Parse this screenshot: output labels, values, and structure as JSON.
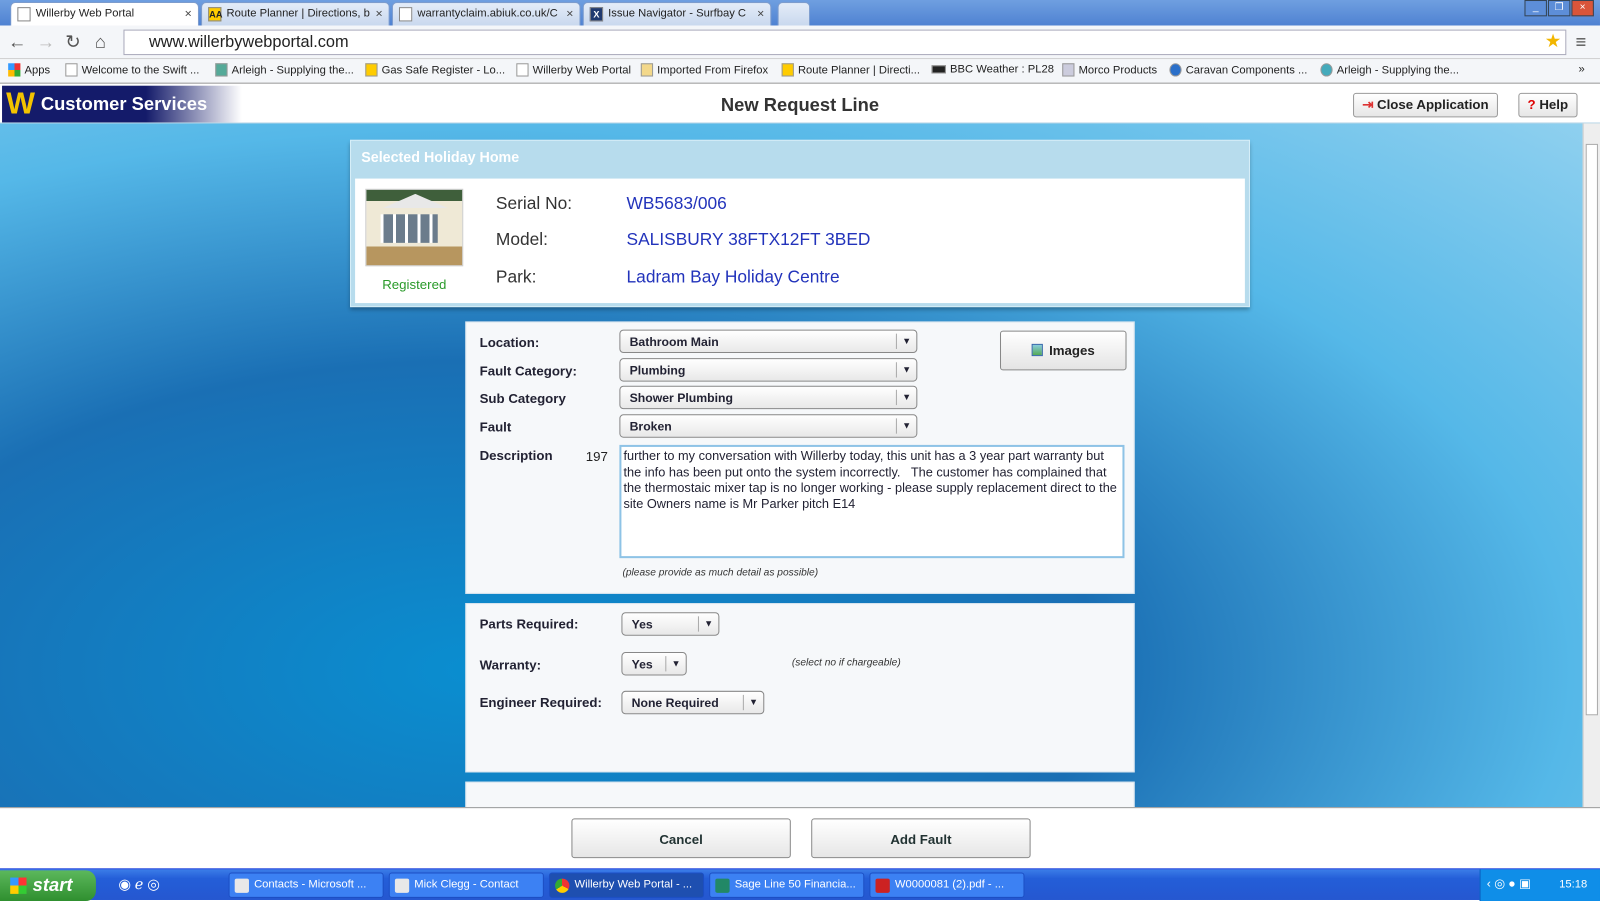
{
  "browser": {
    "tabs": [
      {
        "title": "Willerby Web Portal",
        "icon": "page-icon",
        "active": true
      },
      {
        "title": "Route Planner | Directions, b",
        "icon": "aa-icon"
      },
      {
        "title": "warrantyclaim.abiuk.co.uk/C",
        "icon": "page-icon"
      },
      {
        "title": "Issue Navigator - Surfbay C",
        "icon": "jira-icon"
      }
    ],
    "url": "www.willerbywebportal.com",
    "bookmarks": [
      "Apps",
      "Welcome to the Swift ...",
      "Arleigh - Supplying the...",
      "Gas Safe Register - Lo...",
      "Willerby Web Portal",
      "Imported From Firefox",
      "Route Planner | Directi...",
      "BBC Weather : PL28",
      "Morco Products",
      "Caravan Components ...",
      "Arleigh - Supplying the..."
    ]
  },
  "app": {
    "logo": "Customer Services",
    "title": "New Request Line",
    "close_label": "Close Application",
    "help_label": "Help"
  },
  "holiday_home": {
    "heading": "Selected Holiday Home",
    "status": "Registered",
    "serial_label": "Serial No:",
    "serial": "WB5683/006",
    "model_label": "Model:",
    "model": "SALISBURY 38FTX12FT 3BED",
    "park_label": "Park:",
    "park": "Ladram Bay Holiday Centre"
  },
  "fault": {
    "location_label": "Location:",
    "location": "Bathroom Main",
    "category_label": "Fault Category:",
    "category": "Plumbing",
    "sub_label": "Sub Category",
    "sub": "Shower Plumbing",
    "fault_label": "Fault",
    "fault": "Broken",
    "desc_label": "Description",
    "desc_count": "197",
    "description": "further to my conversation with Willerby today, this unit has a 3 year part warranty but the info has been put onto the system incorrectly.   The customer has complained that the thermostaic mixer tap is no longer working - please supply replacement direct to the site Owners name is Mr Parker pitch E14",
    "desc_hint": "(please provide as much detail as possible)",
    "images_label": "Images"
  },
  "extra": {
    "parts_label": "Parts Required:",
    "parts": "Yes",
    "warranty_label": "Warranty:",
    "warranty": "Yes",
    "warranty_hint": "(select no if chargeable)",
    "engineer_label": "Engineer Required:",
    "engineer": "None Required"
  },
  "footer": {
    "cancel": "Cancel",
    "add": "Add Fault"
  },
  "taskbar": {
    "start": "start",
    "items": [
      "Contacts - Microsoft ...",
      "Mick Clegg - Contact",
      "Willerby Web Portal - ...",
      "Sage Line 50 Financia...",
      "W0000081 (2).pdf - ..."
    ],
    "clock": "15:18"
  }
}
